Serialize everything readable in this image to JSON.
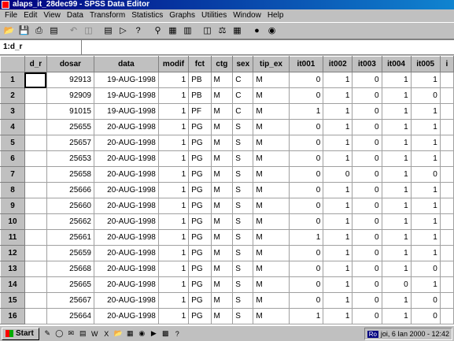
{
  "window": {
    "title": "alaps_it_28dec99 - SPSS Data Editor"
  },
  "menu": [
    "File",
    "Edit",
    "View",
    "Data",
    "Transform",
    "Statistics",
    "Graphs",
    "Utilities",
    "Window",
    "Help"
  ],
  "toolbar": {
    "icons": [
      "open-icon",
      "save-icon",
      "print-icon",
      "dialog-recall-icon",
      "undo-icon",
      "redo-icon",
      "goto-chart-icon",
      "goto-case-icon",
      "variables-icon",
      "find-icon",
      "insert-case-icon",
      "insert-variable-icon",
      "split-file-icon",
      "weight-cases-icon",
      "select-cases-icon",
      "value-labels-icon",
      "use-sets-icon"
    ]
  },
  "cell_ref": "1:d_r",
  "grid": {
    "columns": [
      "d_r",
      "dosar",
      "data",
      "modif",
      "fct",
      "ctg",
      "sex",
      "tip_ex",
      "it001",
      "it002",
      "it003",
      "it004",
      "it005",
      "i"
    ],
    "rows": [
      [
        "1",
        "",
        "92913",
        "19-AUG-1998",
        "1",
        "PB",
        "M",
        "C",
        "M",
        "0",
        "1",
        "0",
        "1",
        "1",
        ""
      ],
      [
        "2",
        "",
        "92909",
        "19-AUG-1998",
        "1",
        "PB",
        "M",
        "C",
        "M",
        "0",
        "1",
        "0",
        "1",
        "0",
        ""
      ],
      [
        "3",
        "",
        "91015",
        "19-AUG-1998",
        "1",
        "PF",
        "M",
        "C",
        "M",
        "1",
        "1",
        "0",
        "1",
        "1",
        ""
      ],
      [
        "4",
        "",
        "25655",
        "20-AUG-1998",
        "1",
        "PG",
        "M",
        "S",
        "M",
        "0",
        "1",
        "0",
        "1",
        "1",
        ""
      ],
      [
        "5",
        "",
        "25657",
        "20-AUG-1998",
        "1",
        "PG",
        "M",
        "S",
        "M",
        "0",
        "1",
        "0",
        "1",
        "1",
        ""
      ],
      [
        "6",
        "",
        "25653",
        "20-AUG-1998",
        "1",
        "PG",
        "M",
        "S",
        "M",
        "0",
        "1",
        "0",
        "1",
        "1",
        ""
      ],
      [
        "7",
        "",
        "25658",
        "20-AUG-1998",
        "1",
        "PG",
        "M",
        "S",
        "M",
        "0",
        "0",
        "0",
        "1",
        "0",
        ""
      ],
      [
        "8",
        "",
        "25666",
        "20-AUG-1998",
        "1",
        "PG",
        "M",
        "S",
        "M",
        "0",
        "1",
        "0",
        "1",
        "1",
        ""
      ],
      [
        "9",
        "",
        "25660",
        "20-AUG-1998",
        "1",
        "PG",
        "M",
        "S",
        "M",
        "0",
        "1",
        "0",
        "1",
        "1",
        ""
      ],
      [
        "10",
        "",
        "25662",
        "20-AUG-1998",
        "1",
        "PG",
        "M",
        "S",
        "M",
        "0",
        "1",
        "0",
        "1",
        "1",
        ""
      ],
      [
        "11",
        "",
        "25661",
        "20-AUG-1998",
        "1",
        "PG",
        "M",
        "S",
        "M",
        "1",
        "1",
        "0",
        "1",
        "1",
        ""
      ],
      [
        "12",
        "",
        "25659",
        "20-AUG-1998",
        "1",
        "PG",
        "M",
        "S",
        "M",
        "0",
        "1",
        "0",
        "1",
        "1",
        ""
      ],
      [
        "13",
        "",
        "25668",
        "20-AUG-1998",
        "1",
        "PG",
        "M",
        "S",
        "M",
        "0",
        "1",
        "0",
        "1",
        "0",
        ""
      ],
      [
        "14",
        "",
        "25665",
        "20-AUG-1998",
        "1",
        "PG",
        "M",
        "S",
        "M",
        "0",
        "1",
        "0",
        "0",
        "1",
        ""
      ],
      [
        "15",
        "",
        "25667",
        "20-AUG-1998",
        "1",
        "PG",
        "M",
        "S",
        "M",
        "0",
        "1",
        "0",
        "1",
        "0",
        ""
      ],
      [
        "16",
        "",
        "25664",
        "20-AUG-1998",
        "1",
        "PG",
        "M",
        "S",
        "M",
        "1",
        "1",
        "0",
        "1",
        "0",
        ""
      ]
    ]
  },
  "taskbar": {
    "start_label": "Start",
    "lang": "Ro",
    "clock": "joi, 6 Ian 2000 - 12:42"
  }
}
